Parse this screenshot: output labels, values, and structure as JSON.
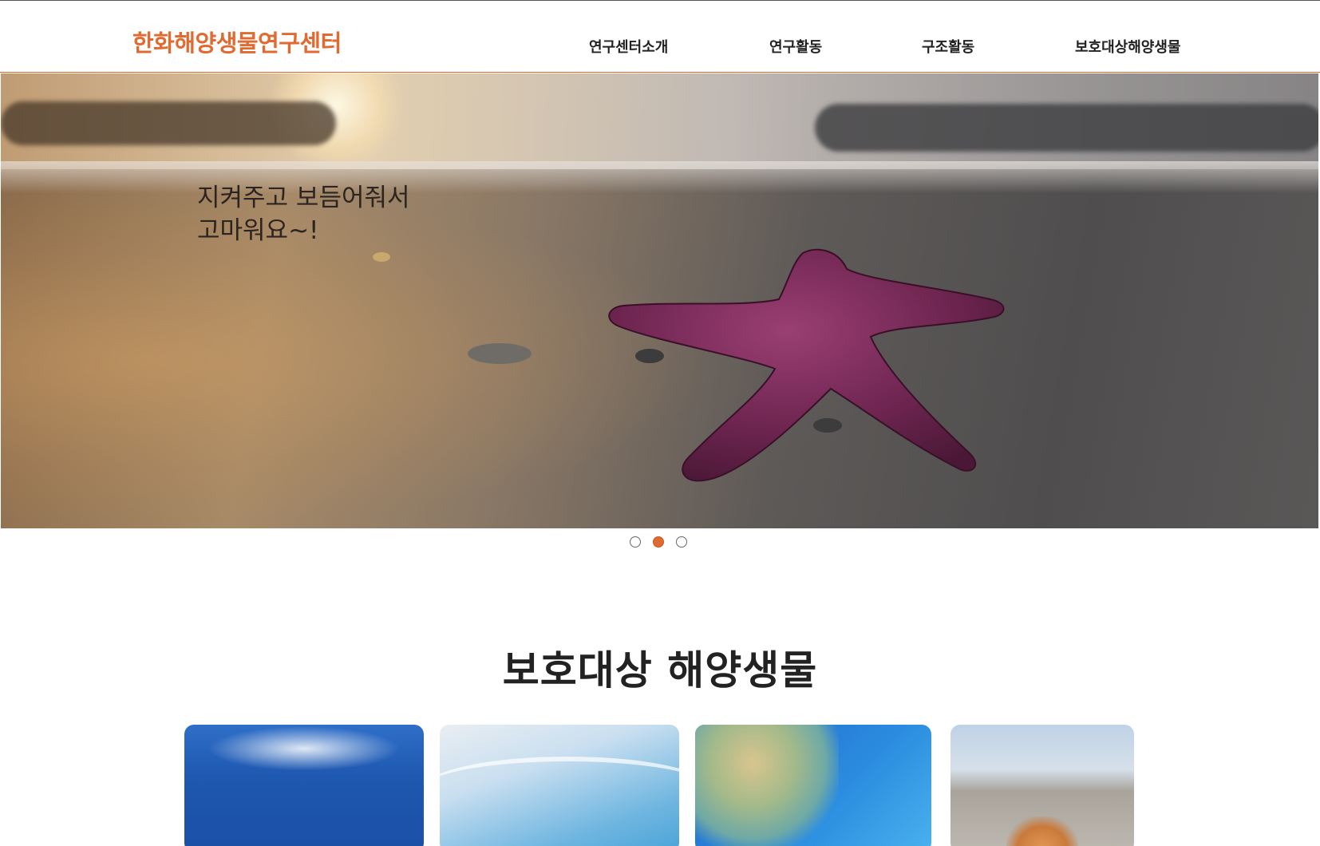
{
  "header": {
    "logo": "한화해양생물연구센터",
    "nav": [
      {
        "label": "연구센터소개"
      },
      {
        "label": "연구활동"
      },
      {
        "label": "구조활동"
      },
      {
        "label": "보호대상해양생물"
      }
    ]
  },
  "hero": {
    "line1": "지켜주고 보듬어줘서",
    "line2": "고마워요~!",
    "image": "starfish-on-beach",
    "slide_count": 3,
    "active_slide": 2
  },
  "section": {
    "title": "보호대상 해양생물"
  },
  "cards": [
    {
      "image": "underwater-blue"
    },
    {
      "image": "shallow-water"
    },
    {
      "image": "sea-turtle"
    },
    {
      "image": "beach-animal"
    }
  ],
  "colors": {
    "accent": "#e2692f",
    "text": "#222222"
  }
}
